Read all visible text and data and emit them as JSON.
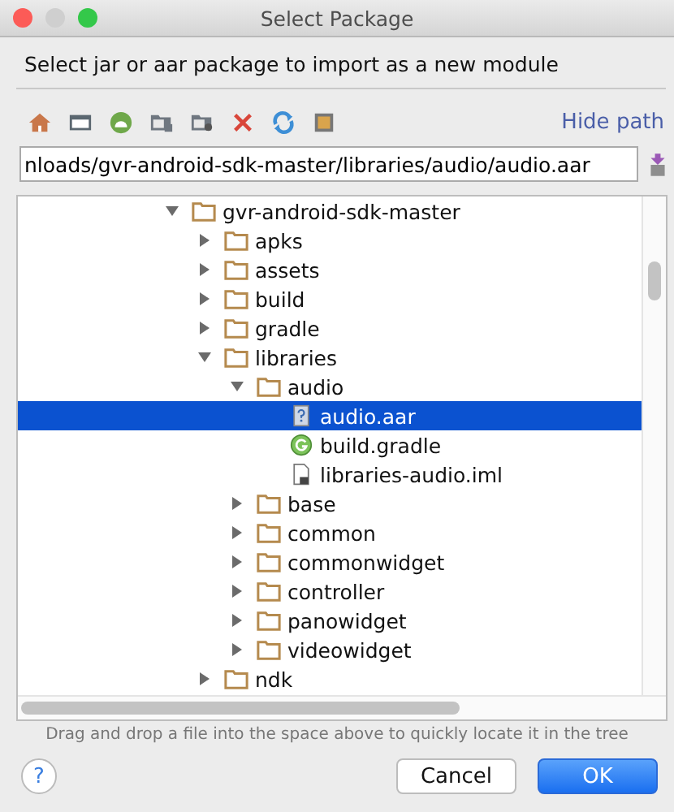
{
  "window": {
    "title": "Select Package"
  },
  "prompt": "Select jar or aar package to import as a new module",
  "toolbar": {
    "hide_path": "Hide path"
  },
  "path_field": {
    "value": "nloads/gvr-android-sdk-master/libraries/audio/audio.aar"
  },
  "tree": [
    {
      "kind": "folder",
      "label": "gvr-android-sdk-master",
      "expanded": true,
      "selected": false,
      "children": [
        {
          "kind": "folder",
          "label": "apks",
          "expanded": false,
          "selected": false
        },
        {
          "kind": "folder",
          "label": "assets",
          "expanded": false,
          "selected": false
        },
        {
          "kind": "folder",
          "label": "build",
          "expanded": false,
          "selected": false
        },
        {
          "kind": "folder",
          "label": "gradle",
          "expanded": false,
          "selected": false
        },
        {
          "kind": "folder",
          "label": "libraries",
          "expanded": true,
          "selected": false,
          "children": [
            {
              "kind": "folder",
              "label": "audio",
              "expanded": true,
              "selected": false,
              "children": [
                {
                  "kind": "unknown-file",
                  "label": "audio.aar",
                  "selected": true
                },
                {
                  "kind": "gradle-file",
                  "label": "build.gradle",
                  "selected": false
                },
                {
                  "kind": "module-file",
                  "label": "libraries-audio.iml",
                  "selected": false
                }
              ]
            },
            {
              "kind": "folder",
              "label": "base",
              "expanded": false,
              "selected": false
            },
            {
              "kind": "folder",
              "label": "common",
              "expanded": false,
              "selected": false
            },
            {
              "kind": "folder",
              "label": "commonwidget",
              "expanded": false,
              "selected": false
            },
            {
              "kind": "folder",
              "label": "controller",
              "expanded": false,
              "selected": false
            },
            {
              "kind": "folder",
              "label": "panowidget",
              "expanded": false,
              "selected": false
            },
            {
              "kind": "folder",
              "label": "videowidget",
              "expanded": false,
              "selected": false
            }
          ]
        },
        {
          "kind": "folder",
          "label": "ndk",
          "expanded": false,
          "selected": false
        }
      ]
    }
  ],
  "hint": "Drag and drop a file into the space above to quickly locate it in the tree",
  "buttons": {
    "help": "?",
    "cancel": "Cancel",
    "ok": "OK"
  }
}
